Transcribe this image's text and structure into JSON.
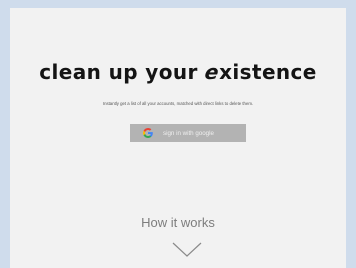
{
  "hero": {
    "headline_start": "clean up your ",
    "headline_special": "e",
    "headline_end": "xistence",
    "tagline": "Instantly get a list of all your accounts, matched with direct links to delete them."
  },
  "signin": {
    "label": "sign in with google",
    "icon": "google-g-icon"
  },
  "how_it_works": {
    "label": "How it works",
    "icon": "chevron-down-icon"
  },
  "colors": {
    "background": "#cfdcec",
    "panel": "#f2f2f2",
    "button": "#b3b3b3",
    "google_red": "#ea4335",
    "google_blue": "#4285f4",
    "google_yellow": "#fbbc05",
    "google_green": "#34a853"
  }
}
